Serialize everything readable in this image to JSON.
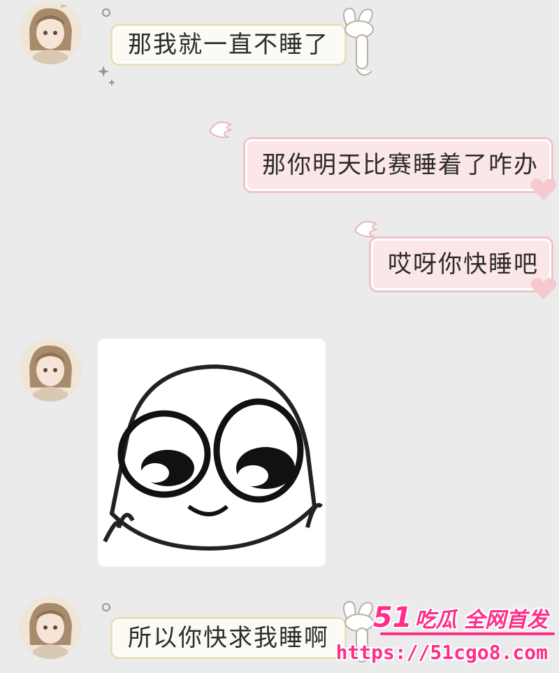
{
  "messages": [
    {
      "side": "left",
      "text": "那我就一直不睡了"
    },
    {
      "side": "right",
      "text": "那你明天比赛睡着了咋办"
    },
    {
      "side": "right",
      "text": "哎呀你快睡吧"
    },
    {
      "side": "left",
      "type": "sticker",
      "icon": "cute-crying-face-sticker"
    },
    {
      "side": "left",
      "text": "所以你快求我睡啊"
    }
  ],
  "watermark": {
    "brand_num": "51",
    "brand_text": "吃瓜 全网首发",
    "url": "https://51cgo8.com"
  },
  "colors": {
    "background": "#ebebeb",
    "left_bubble_border": "#e9dfb8",
    "right_bubble_bg": "#fbe6e8",
    "right_bubble_border": "#f1c3c8",
    "watermark": "#ff2d8a"
  }
}
